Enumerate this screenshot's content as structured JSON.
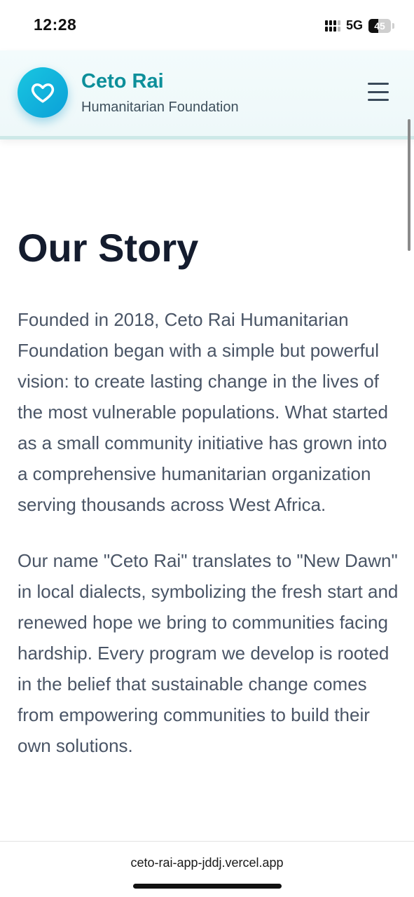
{
  "status_bar": {
    "time": "12:28",
    "network": "5G",
    "battery": "45",
    "battery_level": 0.45
  },
  "header": {
    "logo_icon": "heart-icon",
    "brand_title": "Ceto Rai",
    "brand_subtitle": "Humanitarian Foundation",
    "menu_icon": "hamburger-menu-icon"
  },
  "main": {
    "title": "Our Story",
    "paragraphs": [
      "Founded in 2018, Ceto Rai Humanitarian Foundation began with a simple but powerful vision: to create lasting change in the lives of the most vulnerable populations. What started as a small community initiative has grown into a comprehensive humanitarian organization serving thousands across West Africa.",
      "Our name \"Ceto Rai\" translates to \"New Dawn\" in local dialects, symbolizing the fresh start and renewed hope we bring to communities facing hardship. Every program we develop is rooted in the belief that sustainable change comes from empowering communities to build their own solutions."
    ]
  },
  "browser": {
    "url": "ceto-rai-app-jddj.vercel.app"
  },
  "colors": {
    "brand_teal": "#0d8f9a",
    "logo_gradient_start": "#19c6e0",
    "logo_gradient_end": "#0ba0d8",
    "heading": "#141c2e",
    "body_text": "#4a5566"
  }
}
